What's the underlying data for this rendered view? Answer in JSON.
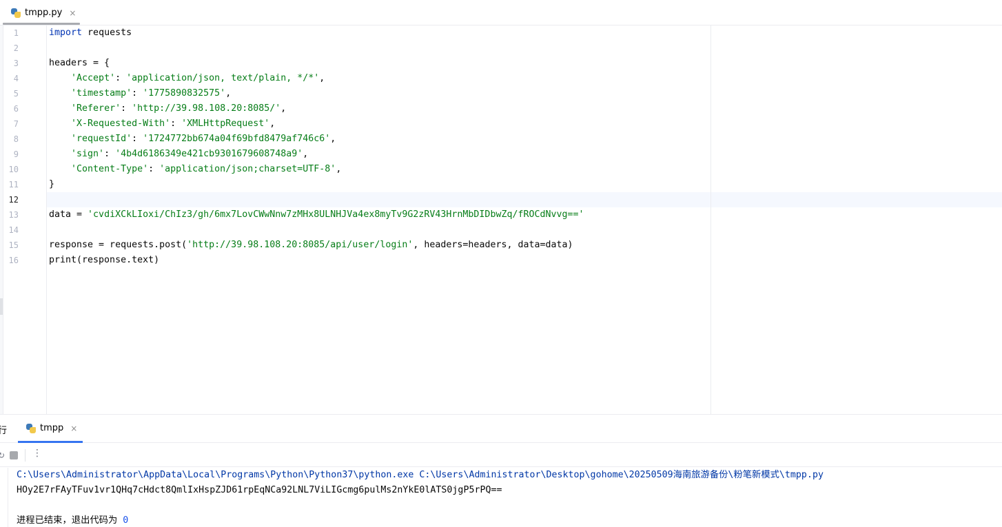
{
  "editor_tab": {
    "label": "tmpp.py",
    "close": "×",
    "icon": "python-file-icon"
  },
  "editor": {
    "active_line": 12,
    "lines": [
      {
        "num": "1",
        "segments": [
          {
            "t": "import",
            "c": "kw"
          },
          {
            "t": " requests",
            "c": ""
          }
        ]
      },
      {
        "num": "2",
        "segments": []
      },
      {
        "num": "3",
        "segments": [
          {
            "t": "headers = {",
            "c": ""
          }
        ]
      },
      {
        "num": "4",
        "segments": [
          {
            "t": "    ",
            "c": ""
          },
          {
            "t": "'Accept'",
            "c": "str"
          },
          {
            "t": ": ",
            "c": ""
          },
          {
            "t": "'application/json, text/plain, */*'",
            "c": "str"
          },
          {
            "t": ",",
            "c": ""
          }
        ]
      },
      {
        "num": "5",
        "segments": [
          {
            "t": "    ",
            "c": ""
          },
          {
            "t": "'timestamp'",
            "c": "str"
          },
          {
            "t": ": ",
            "c": ""
          },
          {
            "t": "'1775890832575'",
            "c": "str"
          },
          {
            "t": ",",
            "c": ""
          }
        ]
      },
      {
        "num": "6",
        "segments": [
          {
            "t": "    ",
            "c": ""
          },
          {
            "t": "'Referer'",
            "c": "str"
          },
          {
            "t": ": ",
            "c": ""
          },
          {
            "t": "'http://39.98.108.20:8085/'",
            "c": "str"
          },
          {
            "t": ",",
            "c": ""
          }
        ]
      },
      {
        "num": "7",
        "segments": [
          {
            "t": "    ",
            "c": ""
          },
          {
            "t": "'X-Requested-With'",
            "c": "str"
          },
          {
            "t": ": ",
            "c": ""
          },
          {
            "t": "'XMLHttpRequest'",
            "c": "str"
          },
          {
            "t": ",",
            "c": ""
          }
        ]
      },
      {
        "num": "8",
        "segments": [
          {
            "t": "    ",
            "c": ""
          },
          {
            "t": "'requestId'",
            "c": "str"
          },
          {
            "t": ": ",
            "c": ""
          },
          {
            "t": "'1724772bb674a04f69bfd8479af746c6'",
            "c": "str"
          },
          {
            "t": ",",
            "c": ""
          }
        ]
      },
      {
        "num": "9",
        "segments": [
          {
            "t": "    ",
            "c": ""
          },
          {
            "t": "'sign'",
            "c": "str"
          },
          {
            "t": ": ",
            "c": ""
          },
          {
            "t": "'4b4d6186349e421cb9301679608748a9'",
            "c": "str"
          },
          {
            "t": ",",
            "c": ""
          }
        ]
      },
      {
        "num": "10",
        "segments": [
          {
            "t": "    ",
            "c": ""
          },
          {
            "t": "'Content-Type'",
            "c": "str"
          },
          {
            "t": ": ",
            "c": ""
          },
          {
            "t": "'application/json;charset=UTF-8'",
            "c": "str"
          },
          {
            "t": ",",
            "c": ""
          }
        ]
      },
      {
        "num": "11",
        "segments": [
          {
            "t": "}",
            "c": ""
          }
        ]
      },
      {
        "num": "12",
        "segments": []
      },
      {
        "num": "13",
        "segments": [
          {
            "t": "data = ",
            "c": ""
          },
          {
            "t": "'cvdiXCkLIoxi/ChIz3/gh/6mx7LovCWwNnw7zMHx8ULNHJVa4ex8myTv9G2zRV43HrnMbDIDbwZq/fROCdNvvg=='",
            "c": "str"
          }
        ]
      },
      {
        "num": "14",
        "segments": []
      },
      {
        "num": "15",
        "segments": [
          {
            "t": "response = requests.post(",
            "c": ""
          },
          {
            "t": "'http://39.98.108.20:8085/api/user/login'",
            "c": "str"
          },
          {
            "t": ", headers=headers, data=data)",
            "c": ""
          }
        ]
      },
      {
        "num": "16",
        "segments": [
          {
            "t": "print(response.text)",
            "c": ""
          }
        ]
      }
    ]
  },
  "run_panel": {
    "title": "行",
    "tab": {
      "label": "tmpp",
      "close": "×",
      "icon": "python-file-icon"
    },
    "toolbar": {
      "rerun_icon": "rerun-icon",
      "stop_icon": "stop-icon",
      "more_label": "⋮"
    },
    "console": {
      "command": "C:\\Users\\Administrator\\AppData\\Local\\Programs\\Python\\Python37\\python.exe C:\\Users\\Administrator\\Desktop\\gohome\\20250509海南旅游备份\\粉笔新模式\\tmpp.py",
      "output": "HOy2E7rFAyTFuv1vr1QHq7cHdct8QmlIxHspZJD61rpEqNCa92LNL7ViLIGcmg6pulMs2nYkE0lATS0jgP5rPQ==",
      "exit_text": "进程已结束，退出代码为 ",
      "exit_code": "0"
    }
  }
}
